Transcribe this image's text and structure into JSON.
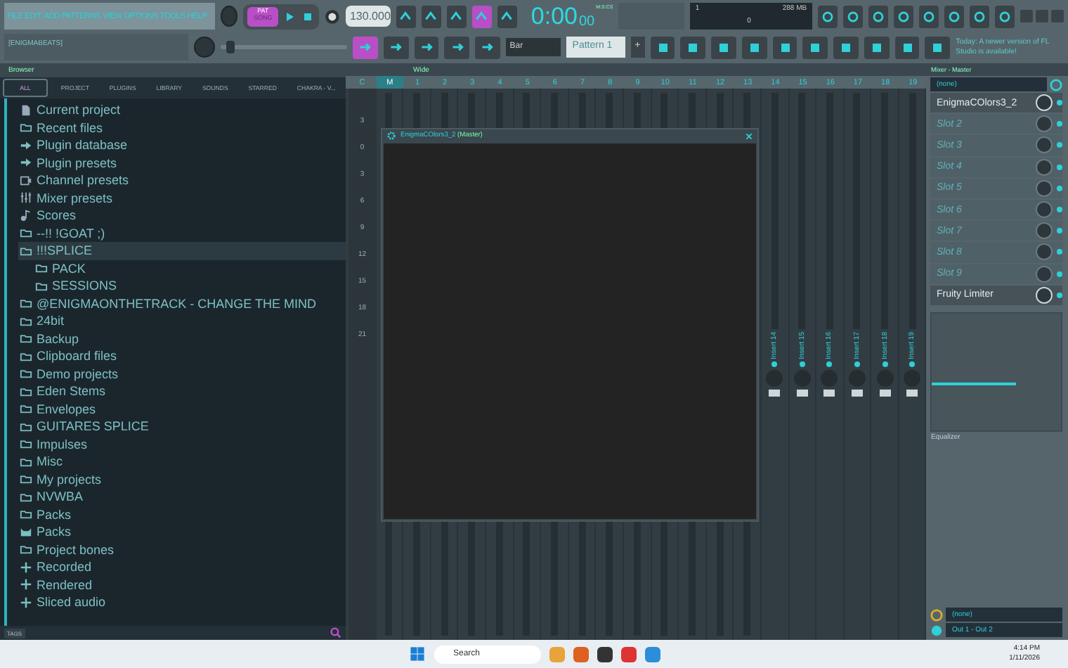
{
  "menu_bar": {
    "menus": [
      "FILE",
      "EDIT",
      "ADD",
      "PATTERNS",
      "VIEW",
      "OPTIONS",
      "TOOLS",
      "HELP"
    ],
    "hint": "[ENIGMABEATS]"
  },
  "transport": {
    "modes": [
      {
        "label": "PAT",
        "selected": true
      },
      {
        "label": "SONG",
        "selected": false
      }
    ],
    "tempo": "130.000",
    "time": "0:00",
    "time_cs": "00",
    "time_format": "M:S:CS",
    "snap": "Bar",
    "pattern": "Pattern 1",
    "pattern_add": "+"
  },
  "master_slider": {
    "level": 0.05
  },
  "tool_buttons": [
    {
      "on": false
    },
    {
      "on": false
    },
    {
      "on": false
    },
    {
      "on": true
    },
    {
      "on": false
    }
  ],
  "cpu": {
    "voices": "1",
    "memory": "288 MB",
    "polyphony": "0"
  },
  "news": "Today: A newer version of FL Studio is available!",
  "browser": {
    "title": "Browser",
    "tabs": [
      {
        "label": "ALL",
        "selected": true
      },
      {
        "label": "PROJECT",
        "selected": false
      },
      {
        "label": "PLUGINS",
        "selected": false
      },
      {
        "label": "LIBRARY",
        "selected": false
      },
      {
        "label": "SOUNDS",
        "selected": false
      },
      {
        "label": "STARRED",
        "selected": false
      },
      {
        "label": "CHAKRA - V...",
        "selected": false
      }
    ],
    "items": [
      {
        "label": "Current project",
        "kind": "file",
        "selected": false
      },
      {
        "label": "Recent files",
        "kind": "folder",
        "selected": false
      },
      {
        "label": "Plugin database",
        "kind": "plugin",
        "selected": false
      },
      {
        "label": "Plugin presets",
        "kind": "plugin",
        "selected": false
      },
      {
        "label": "Channel presets",
        "kind": "channel",
        "selected": false
      },
      {
        "label": "Mixer presets",
        "kind": "mixer",
        "selected": false
      },
      {
        "label": "Scores",
        "kind": "note",
        "selected": false
      },
      {
        "label": "--!! !GOAT ;)",
        "kind": "folder",
        "selected": false
      },
      {
        "label": "!!!SPLICE",
        "kind": "folder",
        "selected": true,
        "expanded": true,
        "children": [
          {
            "label": "PACK",
            "kind": "folder",
            "selected": false
          },
          {
            "label": "SESSIONS",
            "kind": "folder",
            "selected": false
          }
        ]
      },
      {
        "label": "@ENIGMAONTHETRACK - CHANGE THE MIND",
        "kind": "folder",
        "selected": false
      },
      {
        "label": "24bit",
        "kind": "folder",
        "selected": false
      },
      {
        "label": "Backup",
        "kind": "folder",
        "selected": false
      },
      {
        "label": "Clipboard files",
        "kind": "folder",
        "selected": false
      },
      {
        "label": "Demo projects",
        "kind": "folder",
        "selected": false
      },
      {
        "label": "Eden Stems",
        "kind": "folder",
        "selected": false
      },
      {
        "label": "Envelopes",
        "kind": "folder",
        "selected": false
      },
      {
        "label": "GUITARES SPLICE",
        "kind": "folder",
        "selected": false
      },
      {
        "label": "Impulses",
        "kind": "folder",
        "selected": false
      },
      {
        "label": "Misc",
        "kind": "folder",
        "selected": false
      },
      {
        "label": "My projects",
        "kind": "folder",
        "selected": false
      },
      {
        "label": "NVWBA",
        "kind": "folder",
        "selected": false
      },
      {
        "label": "Packs",
        "kind": "folder",
        "selected": false
      },
      {
        "label": "Packs",
        "kind": "packs",
        "selected": false
      },
      {
        "label": "Project bones",
        "kind": "folder",
        "selected": false
      },
      {
        "label": "Recorded",
        "kind": "plus",
        "selected": false
      },
      {
        "label": "Rendered",
        "kind": "plus",
        "selected": false
      },
      {
        "label": "Sliced audio",
        "kind": "plus",
        "selected": false
      }
    ],
    "tags_label": "TAGS"
  },
  "mixer": {
    "title": "Wide",
    "tracks": [
      {
        "label": "C",
        "selected": false
      },
      {
        "label": "M",
        "selected": true
      },
      {
        "label": "1",
        "selected": false
      },
      {
        "label": "2",
        "selected": false
      },
      {
        "label": "3",
        "selected": false
      },
      {
        "label": "4",
        "selected": false
      },
      {
        "label": "5",
        "selected": false
      },
      {
        "label": "6",
        "selected": false
      },
      {
        "label": "7",
        "selected": false
      },
      {
        "label": "8",
        "selected": false
      },
      {
        "label": "9",
        "selected": false
      },
      {
        "label": "10",
        "selected": false
      },
      {
        "label": "11",
        "selected": false
      },
      {
        "label": "12",
        "selected": false
      },
      {
        "label": "13",
        "selected": false
      },
      {
        "label": "14",
        "selected": false,
        "name": "Insert 14"
      },
      {
        "label": "15",
        "selected": false,
        "name": "Insert 15"
      },
      {
        "label": "16",
        "selected": false,
        "name": "Insert 16"
      },
      {
        "label": "17",
        "selected": false,
        "name": "Insert 17"
      },
      {
        "label": "18",
        "selected": false,
        "name": "Insert 18"
      },
      {
        "label": "19",
        "selected": false,
        "name": "Insert 19"
      }
    ],
    "scale": [
      "3",
      "0",
      "3",
      "6",
      "9",
      "12",
      "15",
      "18",
      "21"
    ]
  },
  "plugin_window": {
    "title": "EnigmaCOlors3_2",
    "suffix": "(Master)"
  },
  "mixer_panel": {
    "title": "Mixer - Master",
    "input": "(none)",
    "slots": [
      {
        "name": "EnigmaCOlors3_2",
        "active": true
      },
      {
        "name": "Slot 2",
        "active": false
      },
      {
        "name": "Slot 3",
        "active": false
      },
      {
        "name": "Slot 4",
        "active": false
      },
      {
        "name": "Slot 5",
        "active": false
      },
      {
        "name": "Slot 6",
        "active": false
      },
      {
        "name": "Slot 7",
        "active": false
      },
      {
        "name": "Slot 8",
        "active": false
      },
      {
        "name": "Slot 9",
        "active": false
      },
      {
        "name": "Fruity Limiter",
        "active": true
      }
    ],
    "eq_label": "Equalizer",
    "send": "(none)",
    "output": "Out 1 - Out 2"
  },
  "taskbar": {
    "search": "Search",
    "time": "4:14 PM",
    "date": "1/11/2026"
  }
}
